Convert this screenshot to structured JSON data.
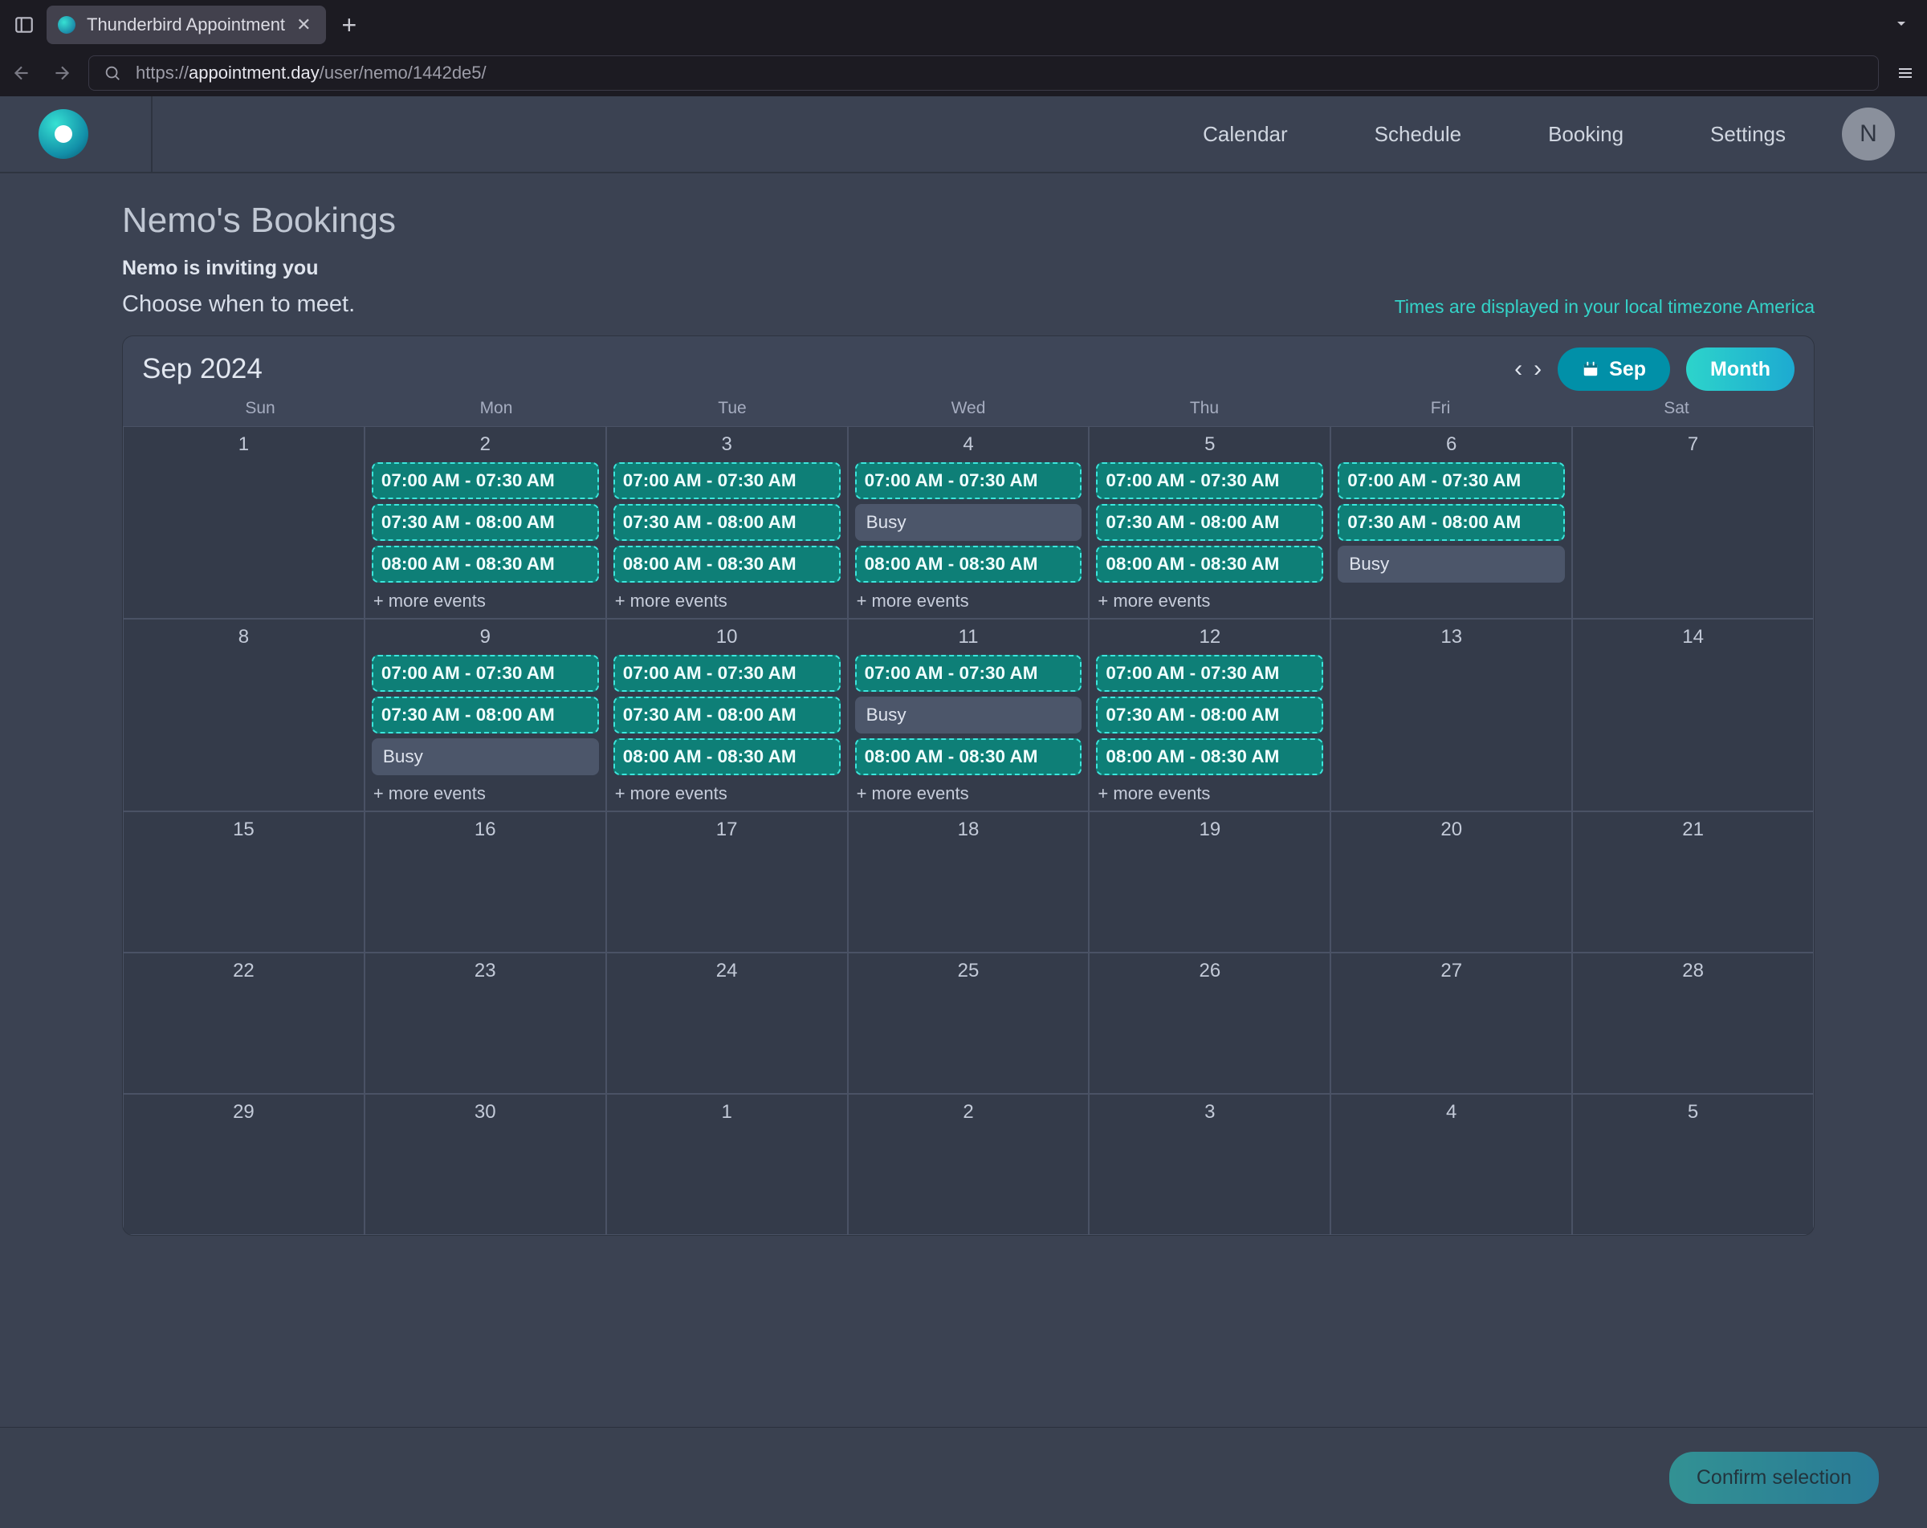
{
  "browser": {
    "tab_title": "Thunderbird Appointment",
    "url_pre": "https://",
    "url_bold": "appointment.day",
    "url_rest": "/user/nemo/1442de5/"
  },
  "nav": {
    "calendar": "Calendar",
    "schedule": "Schedule",
    "booking": "Booking",
    "settings": "Settings",
    "avatar_initial": "N"
  },
  "page": {
    "title": "Nemo's Bookings",
    "inviting": "Nemo is inviting you",
    "choose": "Choose when to meet.",
    "tz_note": "Times are displayed in your local timezone America"
  },
  "calendar": {
    "month_label": "Sep 2024",
    "sep_pill": "Sep",
    "month_pill": "Month",
    "dow": [
      "Sun",
      "Mon",
      "Tue",
      "Wed",
      "Thu",
      "Fri",
      "Sat"
    ],
    "more_label": "+ more events",
    "busy_label": "Busy",
    "days": [
      {
        "num": "1"
      },
      {
        "num": "2",
        "events": [
          {
            "t": "slot",
            "l": "07:00 AM - 07:30 AM"
          },
          {
            "t": "slot",
            "l": "07:30 AM - 08:00 AM"
          },
          {
            "t": "slot",
            "l": "08:00 AM - 08:30 AM"
          }
        ],
        "more": true
      },
      {
        "num": "3",
        "events": [
          {
            "t": "slot",
            "l": "07:00 AM - 07:30 AM"
          },
          {
            "t": "slot",
            "l": "07:30 AM - 08:00 AM"
          },
          {
            "t": "slot",
            "l": "08:00 AM - 08:30 AM"
          }
        ],
        "more": true
      },
      {
        "num": "4",
        "events": [
          {
            "t": "slot",
            "l": "07:00 AM - 07:30 AM"
          },
          {
            "t": "busy"
          },
          {
            "t": "slot",
            "l": "08:00 AM - 08:30 AM"
          }
        ],
        "more": true
      },
      {
        "num": "5",
        "events": [
          {
            "t": "slot",
            "l": "07:00 AM - 07:30 AM"
          },
          {
            "t": "slot",
            "l": "07:30 AM - 08:00 AM"
          },
          {
            "t": "slot",
            "l": "08:00 AM - 08:30 AM"
          }
        ],
        "more": true
      },
      {
        "num": "6",
        "events": [
          {
            "t": "slot",
            "l": "07:00 AM - 07:30 AM"
          },
          {
            "t": "slot",
            "l": "07:30 AM - 08:00 AM"
          },
          {
            "t": "busy"
          }
        ]
      },
      {
        "num": "7"
      },
      {
        "num": "8"
      },
      {
        "num": "9",
        "events": [
          {
            "t": "slot",
            "l": "07:00 AM - 07:30 AM"
          },
          {
            "t": "slot",
            "l": "07:30 AM - 08:00 AM"
          },
          {
            "t": "busy"
          }
        ],
        "more": true
      },
      {
        "num": "10",
        "events": [
          {
            "t": "slot",
            "l": "07:00 AM - 07:30 AM"
          },
          {
            "t": "slot",
            "l": "07:30 AM - 08:00 AM"
          },
          {
            "t": "slot",
            "l": "08:00 AM - 08:30 AM"
          }
        ],
        "more": true
      },
      {
        "num": "11",
        "events": [
          {
            "t": "slot",
            "l": "07:00 AM - 07:30 AM"
          },
          {
            "t": "busy"
          },
          {
            "t": "slot",
            "l": "08:00 AM - 08:30 AM"
          }
        ],
        "more": true
      },
      {
        "num": "12",
        "events": [
          {
            "t": "slot",
            "l": "07:00 AM - 07:30 AM"
          },
          {
            "t": "slot",
            "l": "07:30 AM - 08:00 AM"
          },
          {
            "t": "slot",
            "l": "08:00 AM - 08:30 AM"
          }
        ],
        "more": true
      },
      {
        "num": "13"
      },
      {
        "num": "14"
      },
      {
        "num": "15"
      },
      {
        "num": "16"
      },
      {
        "num": "17"
      },
      {
        "num": "18"
      },
      {
        "num": "19"
      },
      {
        "num": "20"
      },
      {
        "num": "21"
      },
      {
        "num": "22"
      },
      {
        "num": "23"
      },
      {
        "num": "24"
      },
      {
        "num": "25"
      },
      {
        "num": "26"
      },
      {
        "num": "27"
      },
      {
        "num": "28"
      },
      {
        "num": "29"
      },
      {
        "num": "30"
      },
      {
        "num": "1",
        "out": true
      },
      {
        "num": "2",
        "out": true
      },
      {
        "num": "3",
        "out": true
      },
      {
        "num": "4",
        "out": true
      },
      {
        "num": "5",
        "out": true
      }
    ]
  },
  "footer": {
    "confirm": "Confirm selection"
  }
}
